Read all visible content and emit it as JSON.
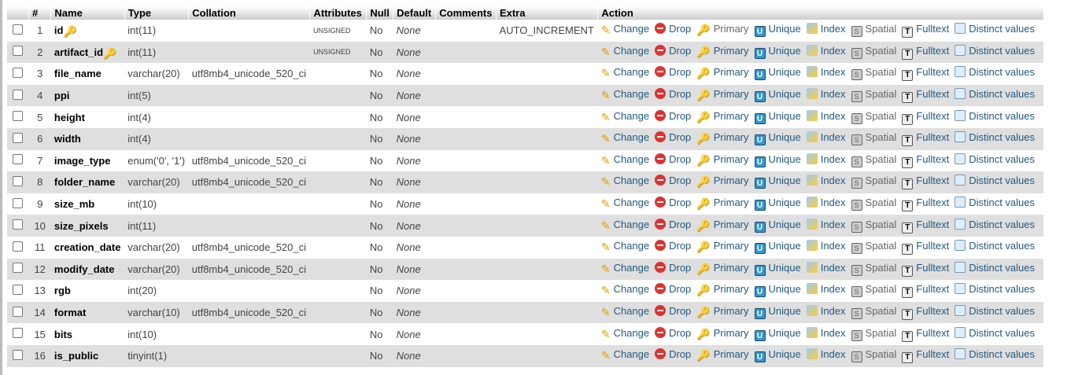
{
  "headers": {
    "num": "#",
    "name": "Name",
    "type": "Type",
    "collation": "Collation",
    "attributes": "Attributes",
    "null": "Null",
    "default": "Default",
    "comments": "Comments",
    "extra": "Extra",
    "action": "Action"
  },
  "actions": {
    "change": "Change",
    "drop": "Drop",
    "primary": "Primary",
    "unique": "Unique",
    "index": "Index",
    "spatial": "Spatial",
    "fulltext": "Fulltext",
    "distinct": "Distinct values"
  },
  "rows": [
    {
      "num": "1",
      "name": "id",
      "key": "primary",
      "type": "int(11)",
      "collation": "",
      "attributes": "UNSIGNED",
      "null": "No",
      "default": "None",
      "comments": "",
      "extra": "AUTO_INCREMENT"
    },
    {
      "num": "2",
      "name": "artifact_id",
      "key": "index",
      "type": "int(11)",
      "collation": "",
      "attributes": "UNSIGNED",
      "null": "No",
      "default": "None",
      "comments": "",
      "extra": ""
    },
    {
      "num": "3",
      "name": "file_name",
      "type": "varchar(20)",
      "collation": "utf8mb4_unicode_520_ci",
      "attributes": "",
      "null": "No",
      "default": "None",
      "comments": "",
      "extra": ""
    },
    {
      "num": "4",
      "name": "ppi",
      "type": "int(5)",
      "collation": "",
      "attributes": "",
      "null": "No",
      "default": "None",
      "comments": "",
      "extra": ""
    },
    {
      "num": "5",
      "name": "height",
      "type": "int(4)",
      "collation": "",
      "attributes": "",
      "null": "No",
      "default": "None",
      "comments": "",
      "extra": ""
    },
    {
      "num": "6",
      "name": "width",
      "type": "int(4)",
      "collation": "",
      "attributes": "",
      "null": "No",
      "default": "None",
      "comments": "",
      "extra": ""
    },
    {
      "num": "7",
      "name": "image_type",
      "type": "enum('0', '1')",
      "collation": "utf8mb4_unicode_520_ci",
      "attributes": "",
      "null": "No",
      "default": "None",
      "comments": "",
      "extra": ""
    },
    {
      "num": "8",
      "name": "folder_name",
      "type": "varchar(20)",
      "collation": "utf8mb4_unicode_520_ci",
      "attributes": "",
      "null": "No",
      "default": "None",
      "comments": "",
      "extra": ""
    },
    {
      "num": "9",
      "name": "size_mb",
      "type": "int(10)",
      "collation": "",
      "attributes": "",
      "null": "No",
      "default": "None",
      "comments": "",
      "extra": ""
    },
    {
      "num": "10",
      "name": "size_pixels",
      "type": "int(11)",
      "collation": "",
      "attributes": "",
      "null": "No",
      "default": "None",
      "comments": "",
      "extra": ""
    },
    {
      "num": "11",
      "name": "creation_date",
      "type": "varchar(20)",
      "collation": "utf8mb4_unicode_520_ci",
      "attributes": "",
      "null": "No",
      "default": "None",
      "comments": "",
      "extra": ""
    },
    {
      "num": "12",
      "name": "modify_date",
      "type": "varchar(20)",
      "collation": "utf8mb4_unicode_520_ci",
      "attributes": "",
      "null": "No",
      "default": "None",
      "comments": "",
      "extra": ""
    },
    {
      "num": "13",
      "name": "rgb",
      "type": "int(20)",
      "collation": "",
      "attributes": "",
      "null": "No",
      "default": "None",
      "comments": "",
      "extra": ""
    },
    {
      "num": "14",
      "name": "format",
      "type": "varchar(10)",
      "collation": "utf8mb4_unicode_520_ci",
      "attributes": "",
      "null": "No",
      "default": "None",
      "comments": "",
      "extra": ""
    },
    {
      "num": "15",
      "name": "bits",
      "type": "int(10)",
      "collation": "",
      "attributes": "",
      "null": "No",
      "default": "None",
      "comments": "",
      "extra": ""
    },
    {
      "num": "16",
      "name": "is_public",
      "type": "tinyint(1)",
      "collation": "",
      "attributes": "",
      "null": "No",
      "default": "None",
      "comments": "",
      "extra": ""
    }
  ]
}
